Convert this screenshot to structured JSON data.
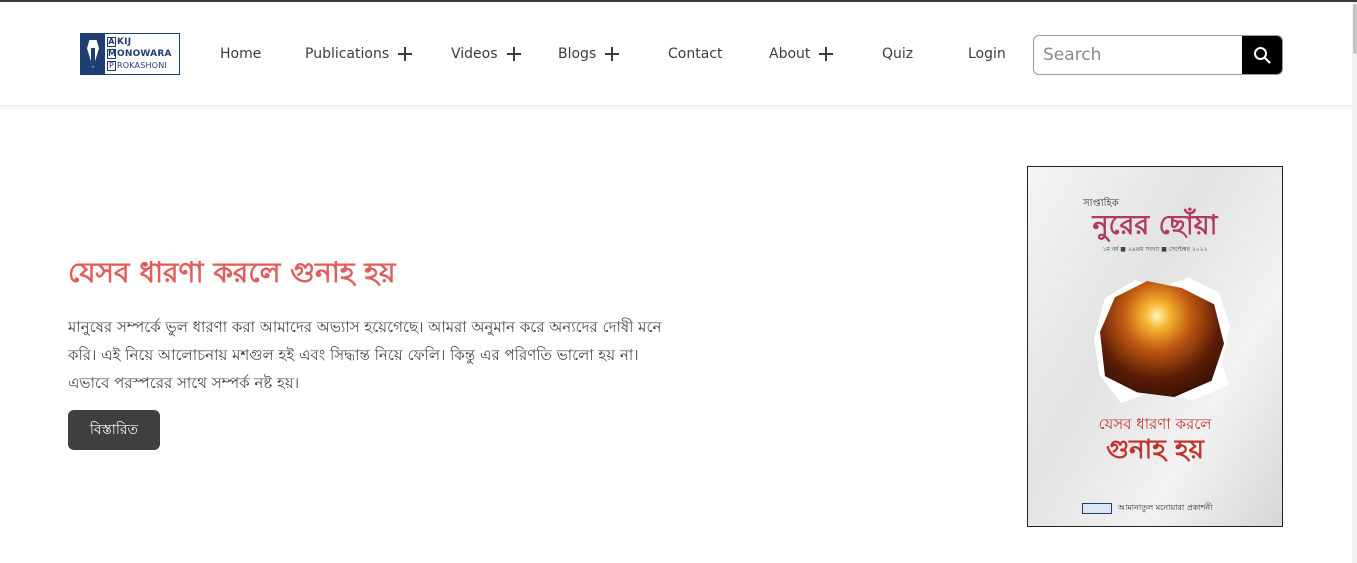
{
  "brand": {
    "logo_lines": [
      {
        "cap": "A",
        "rest": "KIJ"
      },
      {
        "cap": "M",
        "rest": "ONOWARA"
      },
      {
        "cap": "P",
        "rest": "ROKASHONI"
      }
    ]
  },
  "nav": {
    "items": [
      {
        "label": "Home",
        "has_submenu": false
      },
      {
        "label": "Publications",
        "has_submenu": true
      },
      {
        "label": "Videos",
        "has_submenu": true
      },
      {
        "label": "Blogs",
        "has_submenu": true
      },
      {
        "label": "Contact",
        "has_submenu": false
      },
      {
        "label": "About",
        "has_submenu": true
      },
      {
        "label": "Quiz",
        "has_submenu": false
      },
      {
        "label": "Login",
        "has_submenu": false
      }
    ]
  },
  "search": {
    "placeholder": "Search",
    "value": "",
    "icon": "search-icon"
  },
  "hero": {
    "title": "যেসব ধারণা করলে গুনাহ হয়",
    "description": "মানুষের সম্পর্কে ভুল ধারণা করা আমাদের অভ্যাস হয়েগেছে। আমরা অনুমান করে অন্যদের দোষী মনে করি। এই নিয়ে আলোচনায় মশগুল হই এবং সিদ্ধান্ত নিয়ে ফেলি। কিন্তু এর পরিণতি ভালো হয় না। এভাবে পরস্পরের সাথে সম্পর্ক নষ্ট হয়।",
    "button_label": "বিস্তারিত"
  },
  "cover": {
    "kicker": "সাপ্তাহিক",
    "magazine": "নুরের ছোঁয়া",
    "issue": "১ম বর্ষ ■ ২৯তম সংখ্যা ■ সেপ্টেম্বর ২০২২",
    "headline_top": "যেসব ধারণা করলে",
    "headline_bottom": "গুনাহ হয়",
    "publisher": "আমানাতুল মনোয়ারা প্রকাশনী"
  },
  "colors": {
    "accent": "#e05d5b",
    "button_bg": "#3f3f3f",
    "brand_blue": "#1f3f73",
    "search_btn": "#000000"
  }
}
